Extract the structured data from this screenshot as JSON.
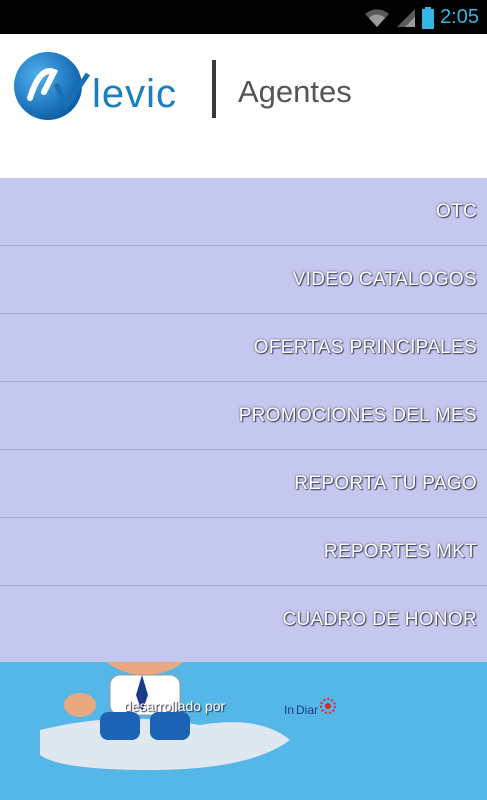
{
  "status_bar": {
    "time": "2:05"
  },
  "header": {
    "brand": "levic",
    "subtitle": "Agentes"
  },
  "menu": {
    "items": [
      {
        "label": "OTC"
      },
      {
        "label": "VIDEO CATALOGOS"
      },
      {
        "label": "OFERTAS PRINCIPALES"
      },
      {
        "label": "PROMOCIONES DEL MES"
      },
      {
        "label": "REPORTA TU PAGO"
      },
      {
        "label": "REPORTES MKT"
      },
      {
        "label": "CUADRO DE HONOR"
      }
    ]
  },
  "footer": {
    "credit": "desarrollado por",
    "developer_logo": "InDiar"
  },
  "colors": {
    "accent": "#33b5e5",
    "menu_bg": "#c4c8ef",
    "wave": "#1a78c2",
    "logo_blue": "#1a7fc1"
  },
  "icons": {
    "wifi": "wifi-icon",
    "signal": "signal-icon",
    "battery": "battery-icon"
  }
}
